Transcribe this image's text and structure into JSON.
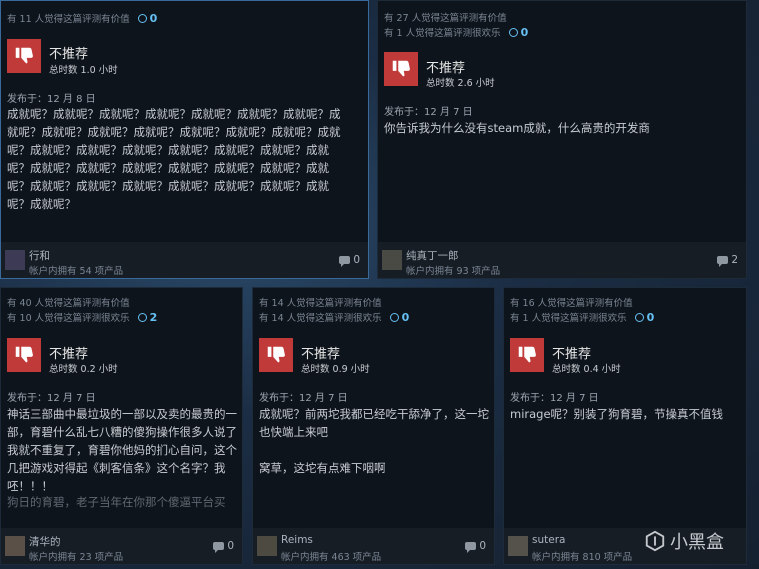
{
  "reviews": [
    {
      "votes_helpful": "有 11 人觉得这篇评测有价值",
      "votes_funny": "",
      "awards": "0",
      "verdict": "不推荐",
      "hours": "总时数 1.0 小时",
      "posted": "发布于：12 月 8 日",
      "text": "成就呢？成就呢？成就呢？成就呢？成就呢？成就呢？成就呢？成就呢？成就呢？成就呢？成就呢？成就呢？成就呢？成就呢？成就呢？成就呢？成就呢？成就呢？成就呢？成就呢？成就呢？成就呢？成就呢？成就呢？成就呢？成就呢？成就呢？成就呢？成就呢？成就呢？成就呢？成就呢？成就呢？成就呢？成就呢？成就呢？成就呢？",
      "user": "行和",
      "owned": "帐户内拥有 54 项产品",
      "comments": "0"
    },
    {
      "votes_helpful": "有 27 人觉得这篇评测有价值",
      "votes_funny": "有 1 人觉得这篇评测很欢乐",
      "awards": "0",
      "verdict": "不推荐",
      "hours": "总时数 2.6 小时",
      "posted": "发布于：12 月 7 日",
      "text": "你告诉我为什么没有steam成就，什么高贵的开发商",
      "user": "纯真丁一郎",
      "owned": "帐户内拥有 93 项产品",
      "comments": "2"
    },
    {
      "votes_helpful": "有 40 人觉得这篇评测有价值",
      "votes_funny": "有 10 人觉得这篇评测很欢乐",
      "awards": "2",
      "verdict": "不推荐",
      "hours": "总时数 0.2 小时",
      "posted": "发布于：12 月 7 日",
      "text": "神话三部曲中最垃圾的一部以及卖的最贵的一部，育碧什么乱七八糟的傻狗操作很多人说了我就不重复了，育碧你他妈的扪心自问，这个几把游戏对得起《刺客信条》这个名字？我呸！！！",
      "text_faded": "狗日的育碧，老子当年在你那个傻逼平台买",
      "user": "清华的",
      "owned": "帐户内拥有 23 项产品",
      "comments": "0"
    },
    {
      "votes_helpful": "有 14 人觉得这篇评测有价值",
      "votes_funny": "有 14 人觉得这篇评测很欢乐",
      "awards": "0",
      "verdict": "不推荐",
      "hours": "总时数 0.9 小时",
      "posted": "发布于：12 月 7 日",
      "text": "成就呢？前两坨我都已经吃干舔净了，这一坨也快端上来吧",
      "text2": "窝草，这坨有点难下咽啊",
      "user": "Reims",
      "owned": "帐户内拥有 463 项产品",
      "comments": "0"
    },
    {
      "votes_helpful": "有 16 人觉得这篇评测有价值",
      "votes_funny": "有 1 人觉得这篇评测很欢乐",
      "awards": "0",
      "verdict": "不推荐",
      "hours": "总时数 0.4 小时",
      "posted": "发布于：12 月 7 日",
      "text": "mirage呢？别装了狗育碧，节操真不值钱",
      "user": "sutera",
      "owned": "帐户内拥有 810 项产品",
      "comments": "0"
    }
  ],
  "watermark": "小黑盒",
  "colors": {
    "thumb_bg": "#c03a3a",
    "award": "#66c0f4",
    "card_bg": "#0e141b",
    "footer_bg": "#171d25"
  }
}
